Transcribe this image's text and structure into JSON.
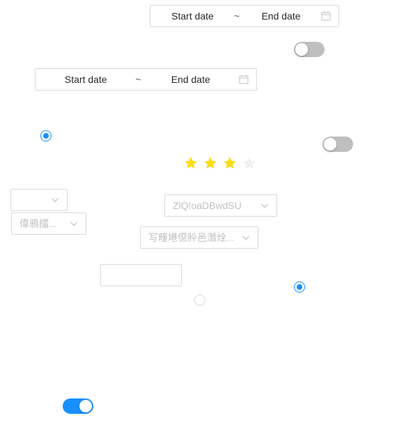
{
  "range_pickers": [
    {
      "start_placeholder": "Start date",
      "separator": "~",
      "end_placeholder": "End date",
      "icon": "calendar-icon"
    },
    {
      "start_placeholder": "Start date",
      "separator": "~",
      "end_placeholder": "End date",
      "icon": "calendar-icon"
    }
  ],
  "switches": [
    {
      "checked": false
    },
    {
      "checked": false
    },
    {
      "checked": true
    }
  ],
  "switch_colors": {
    "off": "#bfbfbf",
    "on": "#1890ff"
  },
  "radios": [
    {
      "checked": true
    },
    {
      "checked": false
    },
    {
      "checked": true
    }
  ],
  "rate": {
    "value": 3,
    "count": 4,
    "filled_color": "#fadb14",
    "empty_color": "#f0f0f0"
  },
  "selects": [
    {
      "value": "",
      "disabled": false
    },
    {
      "value": "偉鴉擂...",
      "disabled": true
    },
    {
      "value": "ZlQ!oaDBwdSU",
      "disabled": true
    },
    {
      "value": "写疃塂僫肸邑潛烇...",
      "disabled": true
    }
  ],
  "text_input": {
    "value": "",
    "placeholder": ""
  }
}
